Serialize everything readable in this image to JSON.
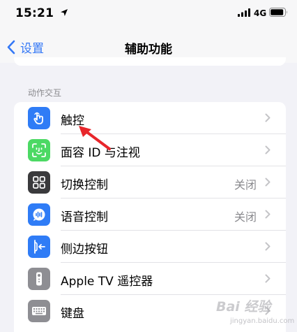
{
  "status_bar": {
    "time": "15:21",
    "network": "4G"
  },
  "nav": {
    "back_label": "设置",
    "title": "辅助功能"
  },
  "section": {
    "header": "动作交互"
  },
  "rows": [
    {
      "label": "触控",
      "value": "",
      "icon": "touch-hand-icon",
      "icon_color": "#2f7cf6"
    },
    {
      "label": "面容 ID 与注视",
      "value": "",
      "icon": "face-id-icon",
      "icon_color": "#4cd964"
    },
    {
      "label": "切换控制",
      "value": "关闭",
      "icon": "switch-control-icon",
      "icon_color": "#3a3a3c"
    },
    {
      "label": "语音控制",
      "value": "关闭",
      "icon": "voice-control-icon",
      "icon_color": "#2f7cf6"
    },
    {
      "label": "侧边按钮",
      "value": "",
      "icon": "side-button-icon",
      "icon_color": "#2f7cf6"
    },
    {
      "label": "Apple TV 遥控器",
      "value": "",
      "icon": "apple-tv-remote-icon",
      "icon_color": "#8e8e93"
    },
    {
      "label": "键盘",
      "value": "",
      "icon": "keyboard-icon",
      "icon_color": "#8e8e93"
    }
  ],
  "watermark": {
    "text": "Bai 经验",
    "url": "jingyan.baidu.com"
  },
  "colors": {
    "accent": "#3478f6",
    "annotation_arrow": "#e8262b"
  }
}
